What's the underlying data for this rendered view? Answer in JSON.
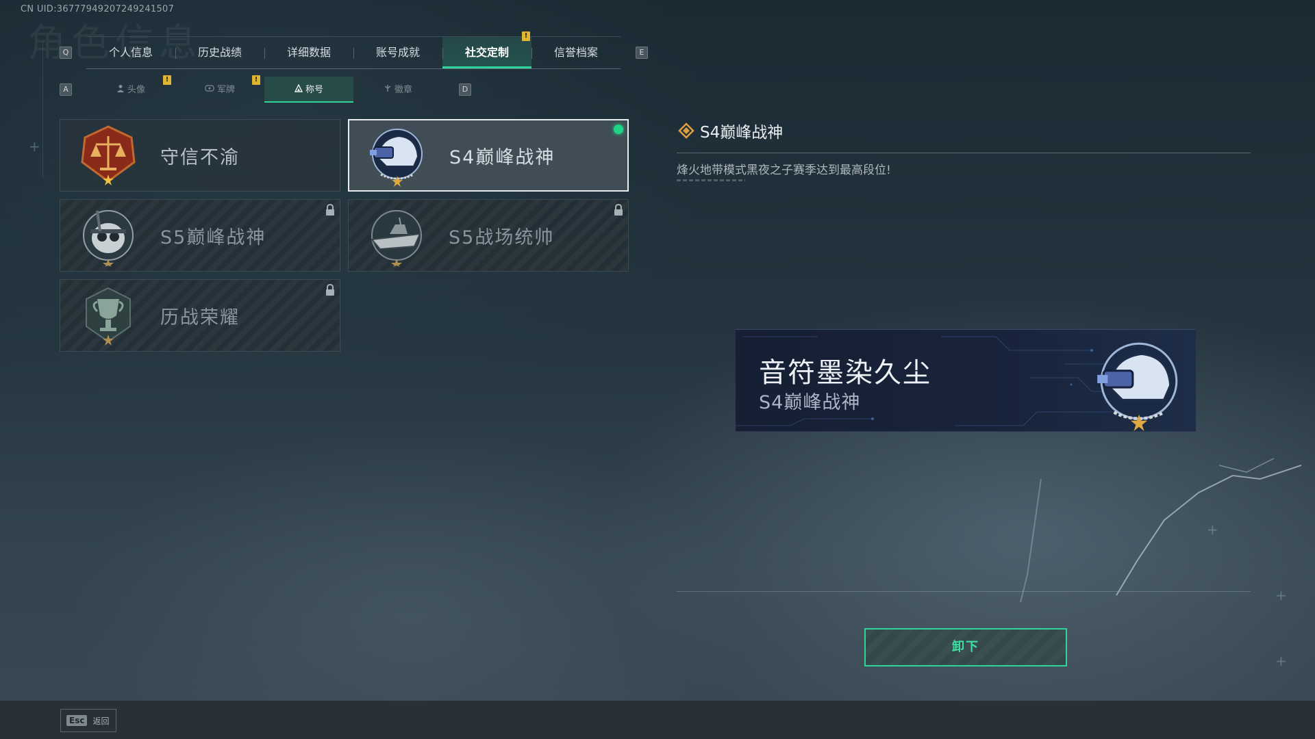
{
  "header": {
    "uid_text": "CN UID:36777949207249241507",
    "background_title": "角色信息"
  },
  "main_tabs": {
    "left_key": "Q",
    "right_key": "E",
    "items": [
      {
        "label": "个人信息"
      },
      {
        "label": "历史战绩"
      },
      {
        "label": "详细数据"
      },
      {
        "label": "账号成就"
      },
      {
        "label": "社交定制",
        "active": true,
        "badge": "!"
      },
      {
        "label": "信誉档案"
      }
    ]
  },
  "sub_tabs": {
    "left_key": "A",
    "right_key": "D",
    "items": [
      {
        "label": "头像",
        "icon": "person-icon",
        "badge": "!"
      },
      {
        "label": "军牌",
        "icon": "dogtag-icon",
        "badge": "!"
      },
      {
        "label": "称号",
        "icon": "title-icon",
        "active": true
      },
      {
        "label": "徽章",
        "icon": "badge-icon"
      }
    ]
  },
  "titles": [
    {
      "name": "守信不渝",
      "emblem": "scales-emblem-icon",
      "locked": false,
      "selected": false
    },
    {
      "name": "S4巅峰战神",
      "emblem": "nightvision-helmet-emblem-icon",
      "locked": false,
      "selected": true,
      "equipped": true
    },
    {
      "name": "S5巅峰战神",
      "emblem": "diver-skull-emblem-icon",
      "locked": true,
      "selected": false
    },
    {
      "name": "S5战场统帅",
      "emblem": "boat-emblem-icon",
      "locked": true,
      "selected": false
    },
    {
      "name": "历战荣耀",
      "emblem": "trophy-emblem-icon",
      "locked": true,
      "selected": false
    }
  ],
  "detail": {
    "title": "S4巅峰战神",
    "description": "烽火地带模式黑夜之子赛季达到最高段位!",
    "preview": {
      "player_name": "音符墨染久尘",
      "title": "S4巅峰战神"
    },
    "action_button": "卸下"
  },
  "footer": {
    "esc_key": "Esc",
    "esc_label": "返回"
  },
  "colors": {
    "accent": "#2fd59a",
    "badge": "#e0b630",
    "equipped": "#1fd486",
    "title_icon": "#e0a040"
  }
}
